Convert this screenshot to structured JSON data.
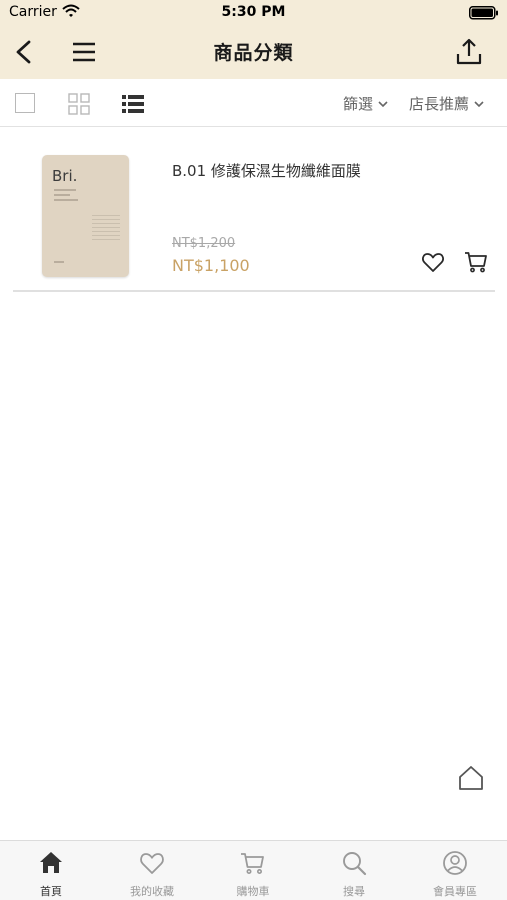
{
  "status_bar": {
    "carrier": "Carrier",
    "time": "5:30 PM"
  },
  "nav": {
    "title": "商品分類"
  },
  "toolbar": {
    "filter_label": "篩選",
    "sort_label": "店長推薦"
  },
  "products": [
    {
      "name": "B.01 修護保濕生物纖維面膜",
      "original_price": "NT$1,200",
      "price": "NT$1,100",
      "image_brand": "Bri."
    }
  ],
  "tabbar": {
    "items": [
      {
        "label": "首頁",
        "icon": "home-icon",
        "active": true
      },
      {
        "label": "我的收藏",
        "icon": "heart-icon",
        "active": false
      },
      {
        "label": "購物車",
        "icon": "cart-icon",
        "active": false
      },
      {
        "label": "搜尋",
        "icon": "search-icon",
        "active": false
      },
      {
        "label": "會員專區",
        "icon": "user-icon",
        "active": false
      }
    ]
  },
  "colors": {
    "header_bg": "#f4ecd9",
    "price": "#c9a265",
    "tab_active": "#333333",
    "tab_inactive": "#999999"
  }
}
